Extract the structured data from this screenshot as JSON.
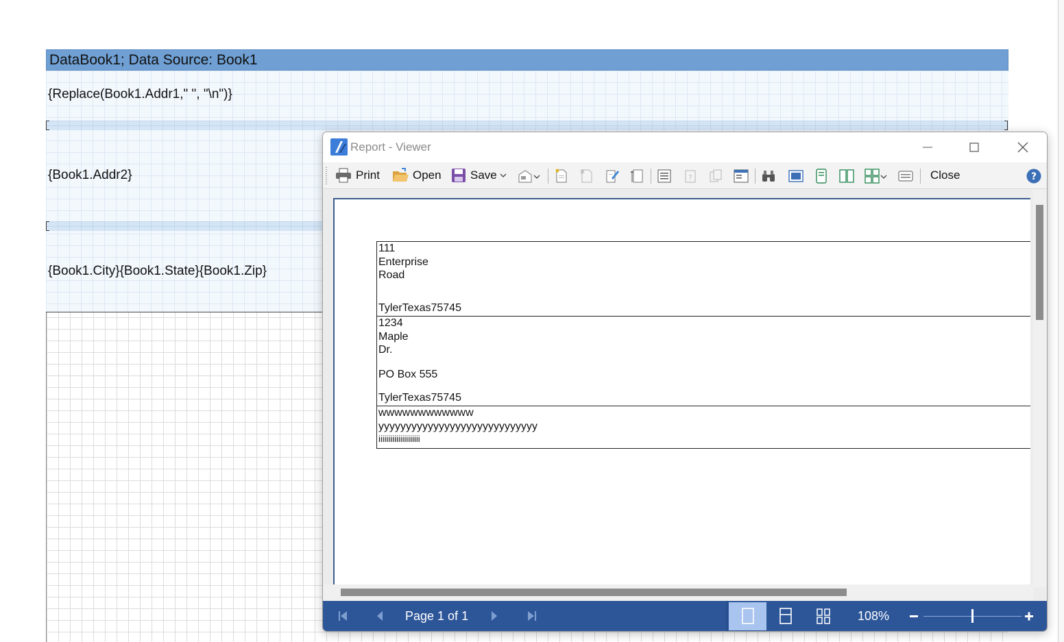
{
  "designer": {
    "band_title": "DataBook1; Data Source: Book1",
    "fields": {
      "addr1": "{Replace(Book1.Addr1,\" \", \"\\n\")}",
      "addr2": "{Book1.Addr2}",
      "city_state_zip": "{Book1.City}{Book1.State}{Book1.Zip}"
    }
  },
  "viewer": {
    "title": "Report - Viewer",
    "toolbar": {
      "print_label": "Print",
      "open_label": "Open",
      "save_label": "Save",
      "close_label": "Close"
    },
    "records": [
      {
        "lines": [
          "111",
          "Enterprise",
          "Road",
          "",
          "TylerTexas75745"
        ]
      },
      {
        "lines": [
          "1234",
          "Maple",
          "Dr.",
          "PO Box 555",
          "TylerTexas75745"
        ]
      },
      {
        "lines": [
          "wwwwwwwwwwww",
          "yyyyyyyyyyyyyyyyyyyyyyyyyyyyy",
          "iiiiiiiiiiiiiiiiiiiii"
        ]
      }
    ],
    "status": {
      "page_label": "Page 1 of 1",
      "zoom_label": "108%"
    },
    "colors": {
      "accent": "#2d5699",
      "band_header": "#6f9fd3",
      "active_view": "#a9c4ee"
    },
    "icons": {
      "app": "report-viewer-icon",
      "minimize": "minimize-icon",
      "maximize": "maximize-icon",
      "close": "close-icon",
      "help": "help-icon"
    }
  }
}
